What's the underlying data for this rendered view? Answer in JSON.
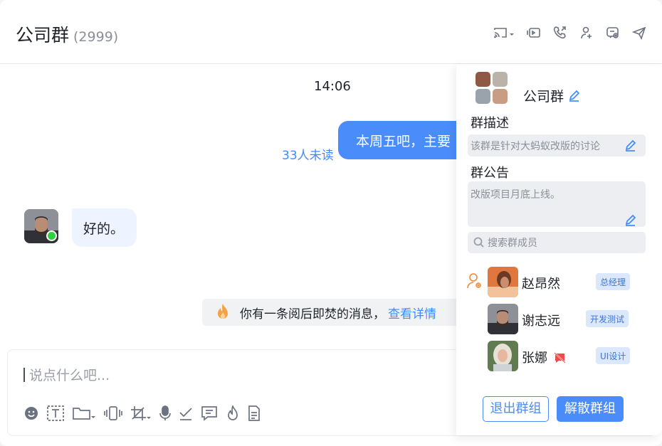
{
  "header": {
    "title": "公司群",
    "member_count": "(2999)"
  },
  "toolbar_icons": [
    "cast-icon",
    "screen-share-icon",
    "phone-call-icon",
    "add-member-icon",
    "group-settings-icon",
    "send-icon"
  ],
  "chat": {
    "timestamp": "14:06",
    "outgoing": {
      "text": "本周五吧，主要",
      "unread": "33人未读"
    },
    "incoming": {
      "text": "好的。",
      "online": true
    },
    "burn_notice": {
      "text": "你有一条阅后即焚的消息，",
      "link": "查看详情"
    }
  },
  "composer": {
    "placeholder": "说点什么吧...",
    "tools": [
      "emoji-icon",
      "text-format-icon",
      "folder-icon",
      "vibrate-icon",
      "screenshot-icon",
      "microphone-icon",
      "check-icon",
      "message-icon",
      "fire-icon",
      "document-icon"
    ]
  },
  "panel": {
    "group_name": "公司群",
    "description_label": "群描述",
    "description": "该群是针对大蚂蚁改版的讨论",
    "notice_label": "群公告",
    "notice": "改版项目月底上线。",
    "search_placeholder": "搜索群成员",
    "members": [
      {
        "name": "赵昂然",
        "tag": "总经理",
        "owner": true,
        "muted": false
      },
      {
        "name": "谢志远",
        "tag": "开发测试",
        "owner": false,
        "muted": false
      },
      {
        "name": "张娜",
        "tag": "UI设计",
        "owner": false,
        "muted": true
      }
    ],
    "quit_label": "退出群组",
    "dissolve_label": "解散群组"
  },
  "colors": {
    "accent": "#4b8cfb",
    "link": "#3d8bff",
    "online": "#2fd13e",
    "owner_icon": "#f08a3c",
    "tag_bg": "#dbe7fb"
  }
}
